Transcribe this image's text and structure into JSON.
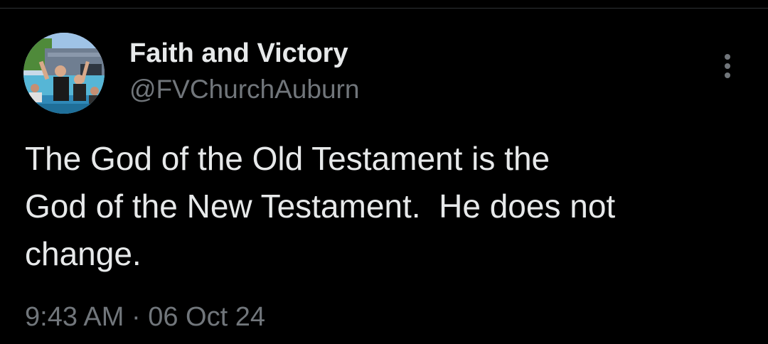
{
  "tweet": {
    "author": {
      "display_name": "Faith and Victory",
      "handle": "@FVChurchAuburn",
      "avatar_icon": "profile-photo-avatar"
    },
    "more_icon": "more-options-icon",
    "text_lines": [
      "The God of the Old Testament is the",
      "God of the New Testament.  He does not",
      "change."
    ],
    "time": "9:43 AM",
    "separator": "·",
    "date": "06 Oct 24"
  },
  "colors": {
    "background": "#000000",
    "primary_text": "#e7e9ea",
    "secondary_text": "#71767b",
    "divider": "#2f3336"
  }
}
